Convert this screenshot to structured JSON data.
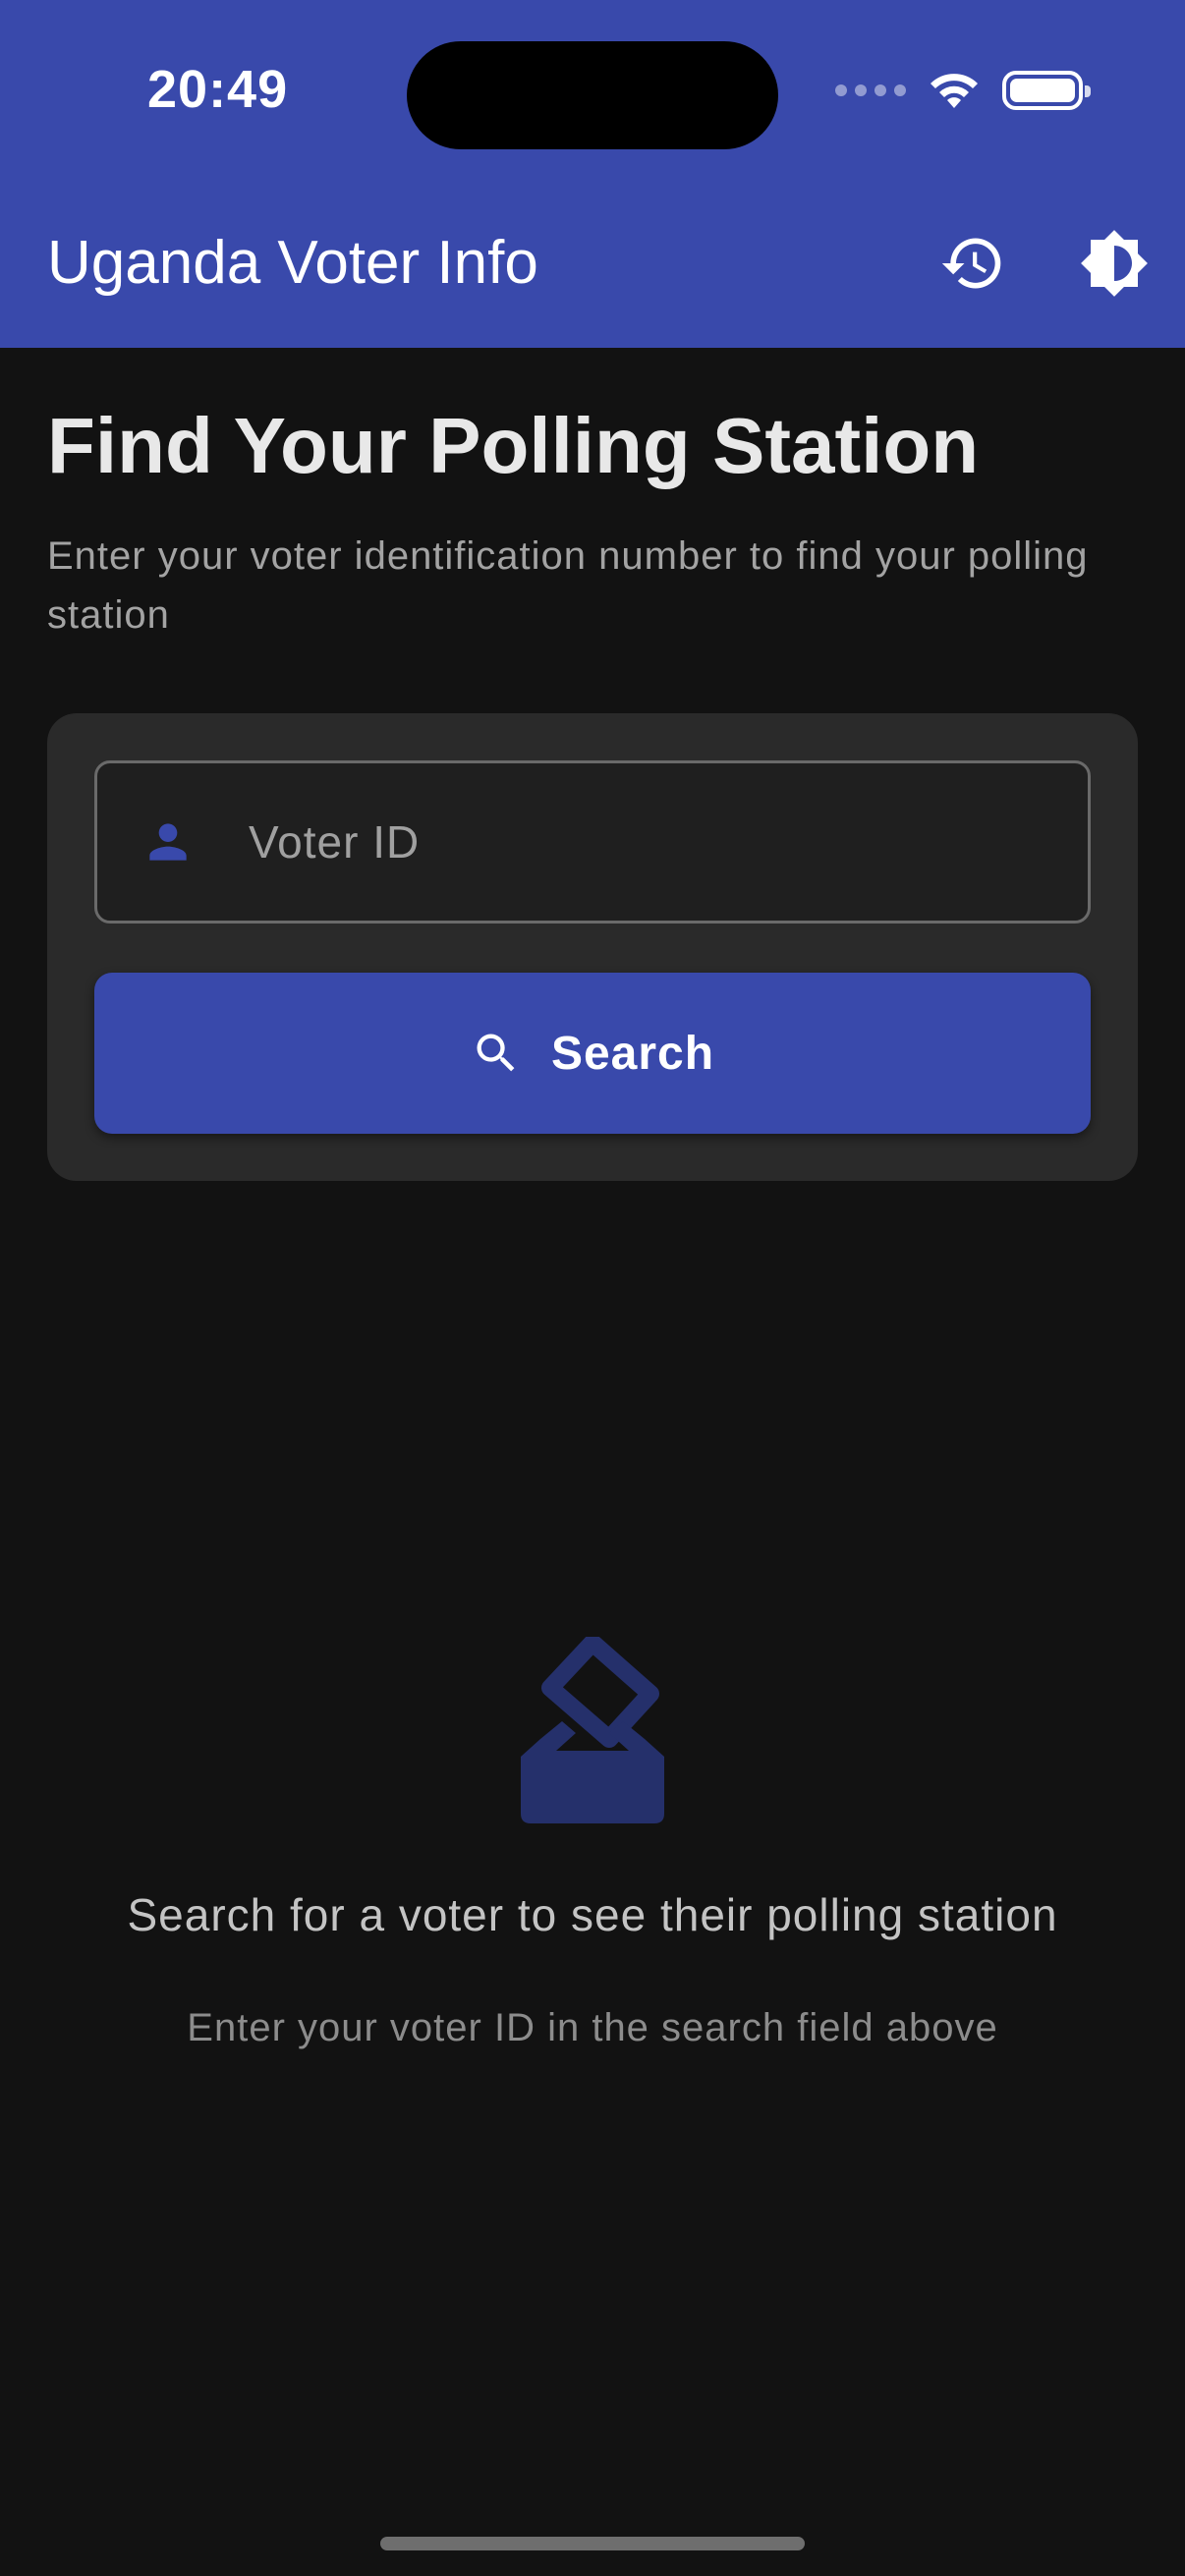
{
  "status_bar": {
    "time": "20:49"
  },
  "app_bar": {
    "title": "Uganda Voter Info",
    "actions": [
      {
        "icon": "history-icon"
      },
      {
        "icon": "brightness-icon"
      }
    ]
  },
  "main": {
    "heading": "Find Your Polling Station",
    "subtitle": "Enter your voter identification number to find your polling station",
    "search": {
      "input_value": "",
      "input_placeholder": "Voter ID",
      "input_icon": "person-icon",
      "button_label": "Search",
      "button_icon": "search-icon"
    },
    "empty_state": {
      "icon": "ballot-box-icon",
      "title": "Search for a voter to see their polling station",
      "subtitle": "Enter your voter ID in the search field above"
    }
  },
  "colors": {
    "primary": "#3949ab",
    "background": "#121212",
    "card": "#2a2a2a",
    "empty_icon": "#25306b"
  }
}
